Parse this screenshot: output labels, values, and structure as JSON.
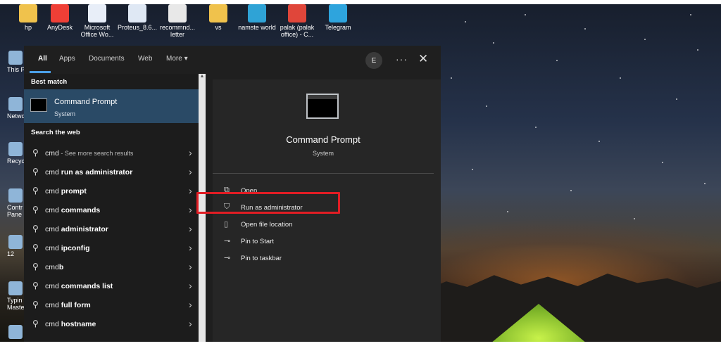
{
  "desktop": {
    "top_icons": [
      {
        "label": "hp",
        "icon": "folder-icon",
        "color": "#f0c24c"
      },
      {
        "label": "AnyDesk",
        "icon": "anydesk-icon",
        "color": "#ef3f36"
      },
      {
        "label": "Microsoft Office Wo...",
        "icon": "word-document-icon",
        "color": "#e8eef8"
      },
      {
        "label": "Proteus_8.6...",
        "icon": "proteus-icon",
        "color": "#dfe8f4"
      },
      {
        "label": "recommnd... letter",
        "icon": "document-icon",
        "color": "#e8e8e8"
      },
      {
        "label": "vs",
        "icon": "folder-icon",
        "color": "#f0c24c"
      },
      {
        "label": "namste world",
        "icon": "edge-icon",
        "color": "#2fa3d6"
      },
      {
        "label": "palak (palak office) - C...",
        "icon": "chrome-icon",
        "color": "#e0463a"
      },
      {
        "label": "Telegram",
        "icon": "telegram-icon",
        "color": "#2ea4dd"
      }
    ],
    "left_icons": [
      {
        "label": "This P",
        "icon": "computer-icon"
      },
      {
        "label": "Netwo",
        "icon": "network-icon"
      },
      {
        "label": "Recycle",
        "icon": "recycle-bin-icon"
      },
      {
        "label": "Contr Pane",
        "icon": "control-panel-icon"
      },
      {
        "label": "12",
        "icon": "document-icon"
      },
      {
        "label": "Typin Master",
        "icon": "typing-master-icon"
      },
      {
        "label": "",
        "icon": "pdf-icon"
      }
    ]
  },
  "search": {
    "tabs": [
      "All",
      "Apps",
      "Documents",
      "Web",
      "More"
    ],
    "more_chevron": "▾",
    "avatar_letter": "E",
    "more_options": "···",
    "close": "✕",
    "best_match_heading": "Best match",
    "best_match": {
      "title": "Command Prompt",
      "subtitle": "System",
      "icon": "command-prompt-icon"
    },
    "web_heading": "Search the web",
    "web_results": [
      {
        "prefix": "cmd",
        "bold": "",
        "suffix": " - See more search results"
      },
      {
        "prefix": "cmd ",
        "bold": "run as administrator",
        "suffix": ""
      },
      {
        "prefix": "cmd ",
        "bold": "prompt",
        "suffix": ""
      },
      {
        "prefix": "cmd ",
        "bold": "commands",
        "suffix": ""
      },
      {
        "prefix": "cmd ",
        "bold": "administrator",
        "suffix": ""
      },
      {
        "prefix": "cmd ",
        "bold": "ipconfig",
        "suffix": ""
      },
      {
        "prefix": "cmd",
        "bold": "b",
        "suffix": ""
      },
      {
        "prefix": "cmd ",
        "bold": "commands list",
        "suffix": ""
      },
      {
        "prefix": "cmd ",
        "bold": "full form",
        "suffix": ""
      },
      {
        "prefix": "cmd ",
        "bold": "hostname",
        "suffix": ""
      }
    ],
    "detail": {
      "title": "Command Prompt",
      "subtitle": "System",
      "actions": [
        {
          "label": "Open",
          "icon": "open-icon"
        },
        {
          "label": "Run as administrator",
          "icon": "shield-icon"
        },
        {
          "label": "Open file location",
          "icon": "file-location-icon"
        },
        {
          "label": "Pin to Start",
          "icon": "pin-icon"
        },
        {
          "label": "Pin to taskbar",
          "icon": "pin-icon"
        }
      ],
      "highlighted_action": "Run as administrator",
      "highlight_color": "#e11d24"
    },
    "accent_color": "#4ba0e8"
  }
}
